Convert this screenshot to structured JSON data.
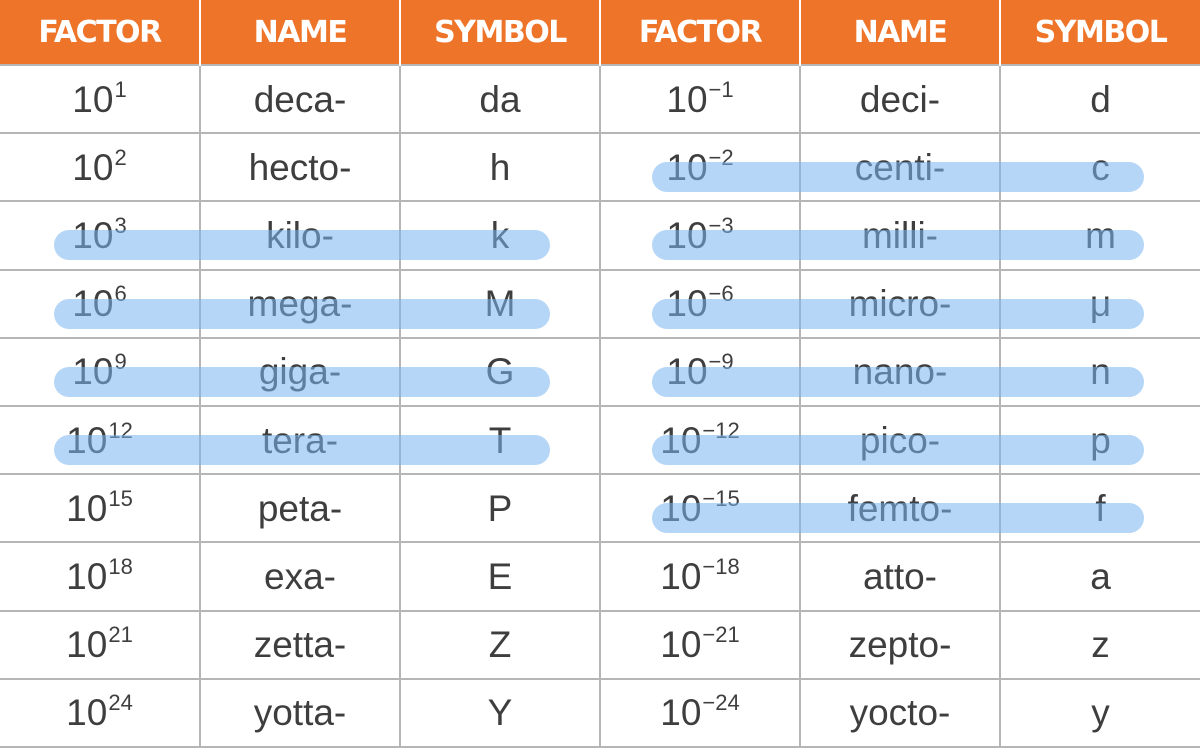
{
  "headers": [
    "FACTOR",
    "NAME",
    "SYMBOL",
    "FACTOR",
    "NAME",
    "SYMBOL"
  ],
  "rows": [
    {
      "left": {
        "base": "10",
        "exp": "1",
        "name": "deca-",
        "symbol": "da"
      },
      "right": {
        "base": "10",
        "exp": "−1",
        "name": "deci-",
        "symbol": "d"
      }
    },
    {
      "left": {
        "base": "10",
        "exp": "2",
        "name": "hecto-",
        "symbol": "h"
      },
      "right": {
        "base": "10",
        "exp": "−2",
        "name": "centi-",
        "symbol": "c"
      }
    },
    {
      "left": {
        "base": "10",
        "exp": "3",
        "name": "kilo-",
        "symbol": "k"
      },
      "right": {
        "base": "10",
        "exp": "−3",
        "name": "milli-",
        "symbol": "m"
      }
    },
    {
      "left": {
        "base": "10",
        "exp": "6",
        "name": "mega-",
        "symbol": "M"
      },
      "right": {
        "base": "10",
        "exp": "−6",
        "name": "micro-",
        "symbol": "μ"
      }
    },
    {
      "left": {
        "base": "10",
        "exp": "9",
        "name": "giga-",
        "symbol": "G"
      },
      "right": {
        "base": "10",
        "exp": "−9",
        "name": "nano-",
        "symbol": "n"
      }
    },
    {
      "left": {
        "base": "10",
        "exp": "12",
        "name": "tera-",
        "symbol": "T"
      },
      "right": {
        "base": "10",
        "exp": "−12",
        "name": "pico-",
        "symbol": "p"
      }
    },
    {
      "left": {
        "base": "10",
        "exp": "15",
        "name": "peta-",
        "symbol": "P"
      },
      "right": {
        "base": "10",
        "exp": "−15",
        "name": "femto-",
        "symbol": "f"
      }
    },
    {
      "left": {
        "base": "10",
        "exp": "18",
        "name": "exa-",
        "symbol": "E"
      },
      "right": {
        "base": "10",
        "exp": "−18",
        "name": "atto-",
        "symbol": "a"
      }
    },
    {
      "left": {
        "base": "10",
        "exp": "21",
        "name": "zetta-",
        "symbol": "Z"
      },
      "right": {
        "base": "10",
        "exp": "−21",
        "name": "zepto-",
        "symbol": "z"
      }
    },
    {
      "left": {
        "base": "10",
        "exp": "24",
        "name": "yotta-",
        "symbol": "Y"
      },
      "right": {
        "base": "10",
        "exp": "−24",
        "name": "yocto-",
        "symbol": "y"
      }
    }
  ],
  "highlighted": {
    "left": [
      "kilo-",
      "mega-",
      "giga-",
      "tera-"
    ],
    "right": [
      "centi-",
      "milli-",
      "micro-",
      "nano-",
      "pico-",
      "femto-"
    ]
  },
  "colors": {
    "header_bg": "#ee7429",
    "header_text": "#ffffff",
    "cell_text": "#3e3e3e",
    "grid": "#b6b6b6",
    "highlight": "#78b4f0"
  }
}
